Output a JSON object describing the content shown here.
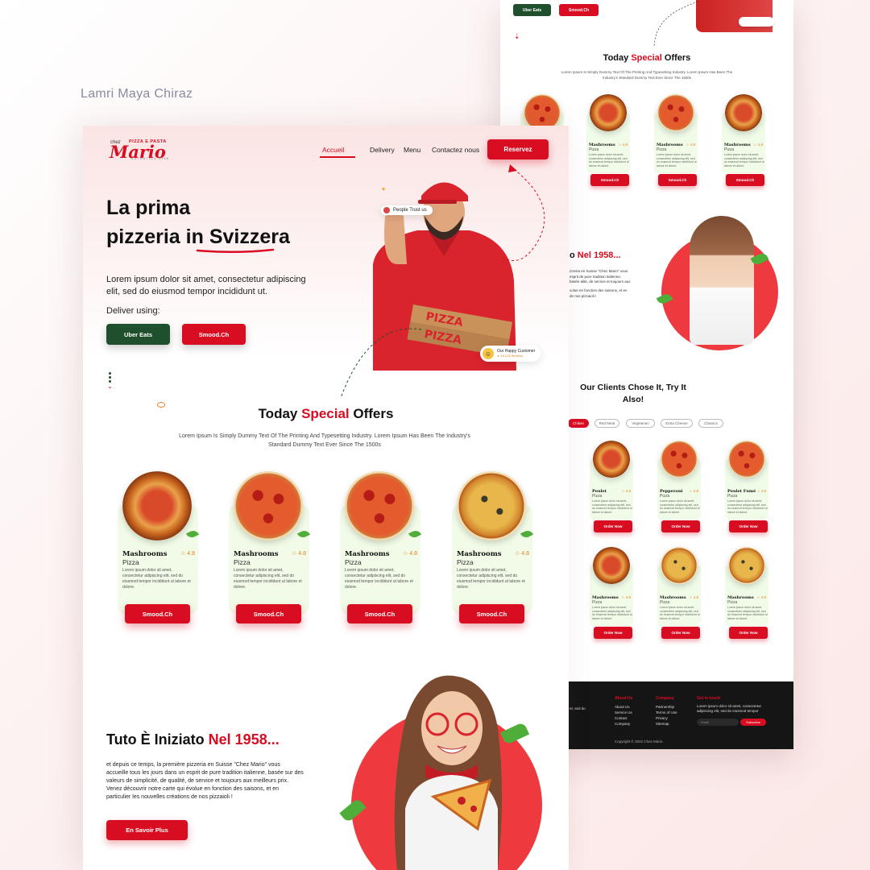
{
  "author": "Lamri Maya Chiraz",
  "brand": {
    "chez": "chez",
    "tag": "PIZZA E PASTA",
    "name": "Mario",
    "sub": "AUTENTICO 1958"
  },
  "nav": {
    "items": [
      "Accueil",
      "Delivery",
      "Menu",
      "Contactez nous"
    ],
    "cta": "Reservez"
  },
  "hero": {
    "line1": "La prima",
    "line2a": "pizzeria in ",
    "line2b": "Svizzera",
    "lead": "Lorem ipsum dolor sit amet, consectetur adipiscing elit, sed do eiusmod tempor incididunt ut.",
    "deliver_label": "Deliver using:",
    "btn_uber": "Uber Eats",
    "btn_smood": "Smood.Ch",
    "badge_trust": "People Trust us",
    "badge_customer": "Our Happy Customer",
    "badge_rating": "★ 4.8 (12k Reviews)"
  },
  "offers": {
    "title_a": "Today ",
    "title_hl": "Special",
    "title_b": " Offers",
    "subtitle": "Lorem Ipsum Is Simply Dummy Text Of The Printing And Typesetting Industry. Lorem Ipsum Has Been The Industry's Standard Dummy Text Ever Since The 1500s",
    "cards": [
      {
        "name": "Mashrooms",
        "type": "Pizza",
        "rating": "4.8",
        "desc": "Lorem ipsum dolor sit amet, consectetur adipiscing elit, sed do eiusmod tempor incididunt ut labore et dolore.",
        "button": "Smood.Ch"
      },
      {
        "name": "Mashrooms",
        "type": "Pizza",
        "rating": "4.8",
        "desc": "Lorem ipsum dolor sit amet, consectetur adipiscing elit, sed do eiusmod tempor incididunt ut labore et dolore.",
        "button": "Smood.Ch"
      },
      {
        "name": "Mashrooms",
        "type": "Pizza",
        "rating": "4.8",
        "desc": "Lorem ipsum dolor sit amet, consectetur adipiscing elit, sed do eiusmod tempor incididunt ut labore et dolore.",
        "button": "Smood.Ch"
      },
      {
        "name": "Mashrooms",
        "type": "Pizza",
        "rating": "4.8",
        "desc": "Lorem ipsum dolor sit amet, consectetur adipiscing elit, sed do eiusmod tempor incididunt ut labore et dolore.",
        "button": "Smood.Ch"
      }
    ]
  },
  "story": {
    "title_a": "Tuto È Iniziato ",
    "title_hl": "Nel 1958...",
    "p1": "et depuis ce temps, la première pizzeria en Suisse \"Chez Mario\" vous accueille tous les jours dans un esprit de pure tradition italienne, basée sur des valeurs de simplicité, de qualité, de service et toujours aux meilleurs prix.",
    "p2": "Venez découvrir notre carte qui évolue en fonction des saisons, et en particulier les nouvelles créations de nos pizzaioli !",
    "button": "En Savoir Plus"
  },
  "back": {
    "btn_uber": "Uber Eats",
    "btn_smood": "Smood.Ch",
    "offers_title_a": "Today ",
    "offers_title_hl": "Special",
    "offers_title_b": " Offers",
    "offers_sub": "Lorem Ipsum Is Simply Dummy Text Of The Printing And Typesetting Industry. Lorem Ipsum Has Been The Industry's Standard Dummy Text Ever Since The 1500s",
    "offer_cards": [
      {
        "name": "Mashrooms",
        "type": "Pizza",
        "rating": "4.8",
        "button": "Smood.Ch"
      },
      {
        "name": "Mashrooms",
        "type": "Pizza",
        "rating": "4.8",
        "button": "Smood.Ch"
      },
      {
        "name": "Mashrooms",
        "type": "Pizza",
        "rating": "4.8",
        "button": "Smood.Ch"
      }
    ],
    "card_desc": "Lorem ipsum dolor sit amet, consectetur adipiscing elit, sed do eiusmod tempor incididunt ut labore et dolore.",
    "story_title_a": "o ",
    "story_title_hl": "Nel 1958...",
    "story_p1": "izzeria en Suisse \"Chez Mario\" vous esprit de pure tradition italienne, basée alité, de service et toujours aux",
    "story_p2": "volue en fonction des saisons, et en de nos pizzaioli !",
    "clients_title": "Our Clients Chose It, Try It Also!",
    "filters": [
      "Chiken",
      "Red Meat",
      "Vegetarien",
      "Extra Cheese",
      "Classics"
    ],
    "menu_row1": [
      {
        "name": "Poulet",
        "type": "Pizza",
        "rating": "4.8",
        "button": "Order Now"
      },
      {
        "name": "Pepperoni",
        "type": "Pizza",
        "rating": "4.8",
        "button": "Order Now"
      },
      {
        "name": "Poulet Fumé",
        "type": "Pizza",
        "rating": "4.8",
        "button": "Order Now"
      }
    ],
    "menu_row2": [
      {
        "name": "Mashrooms",
        "type": "Pizza",
        "rating": "4.8",
        "button": "Order Now"
      },
      {
        "name": "Mashrooms",
        "type": "Pizza",
        "rating": "4.8",
        "button": "Order Now"
      },
      {
        "name": "Mashrooms",
        "type": "Pizza",
        "rating": "4.8",
        "button": "Order Now"
      }
    ],
    "footer": {
      "left_text": "et, sed do",
      "about_head": "About Us",
      "about_items": [
        "About Us",
        "Service Us",
        "Contact",
        "Company"
      ],
      "company_head": "Company",
      "company_items": [
        "Partnership",
        "Terms of Use",
        "Privacy",
        "Sitemap"
      ],
      "touch_head": "Get in touch",
      "touch_text": "Lorem ipsum dolor sit amet, consectetur adipiscing elit, sed do eiusmod tempor",
      "email_placeholder": "Email",
      "subscribe": "Subscribe",
      "copyright": "Copyright © 2022 Chez Mario."
    }
  },
  "colors": {
    "accent": "#d90d22",
    "green": "#1f4f2c",
    "card_bg": "#f1fbe7",
    "footer": "#151515"
  }
}
